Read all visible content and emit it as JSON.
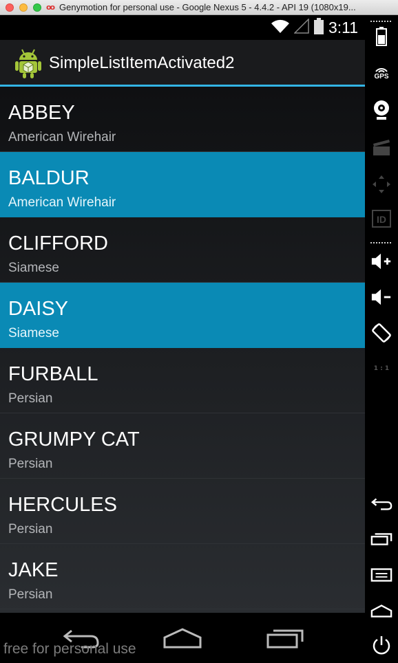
{
  "window": {
    "title": "Genymotion for personal use - Google Nexus 5 - 4.4.2 - API 19 (1080x19...",
    "title_icon": "oo"
  },
  "statusbar": {
    "time": "3:11"
  },
  "actionbar": {
    "title": "SimpleListItemActivated2"
  },
  "list": {
    "items": [
      {
        "title": "ABBEY",
        "subtitle": "American Wirehair",
        "activated": false
      },
      {
        "title": "BALDUR",
        "subtitle": "American Wirehair",
        "activated": true
      },
      {
        "title": "CLIFFORD",
        "subtitle": "Siamese",
        "activated": false
      },
      {
        "title": "DAISY",
        "subtitle": "Siamese",
        "activated": true
      },
      {
        "title": "FURBALL",
        "subtitle": "Persian",
        "activated": false
      },
      {
        "title": "GRUMPY CAT",
        "subtitle": "Persian",
        "activated": false
      },
      {
        "title": "HERCULES",
        "subtitle": "Persian",
        "activated": false
      },
      {
        "title": "JAKE",
        "subtitle": "Persian",
        "activated": false
      }
    ]
  },
  "watermark": "free for personal use",
  "sidepanel": {
    "gps_label": "GPS",
    "id_label": "ID",
    "pixel_label": "1 : 1"
  },
  "colors": {
    "accent": "#33b5e5",
    "activated_row": "#0a8ab5"
  }
}
